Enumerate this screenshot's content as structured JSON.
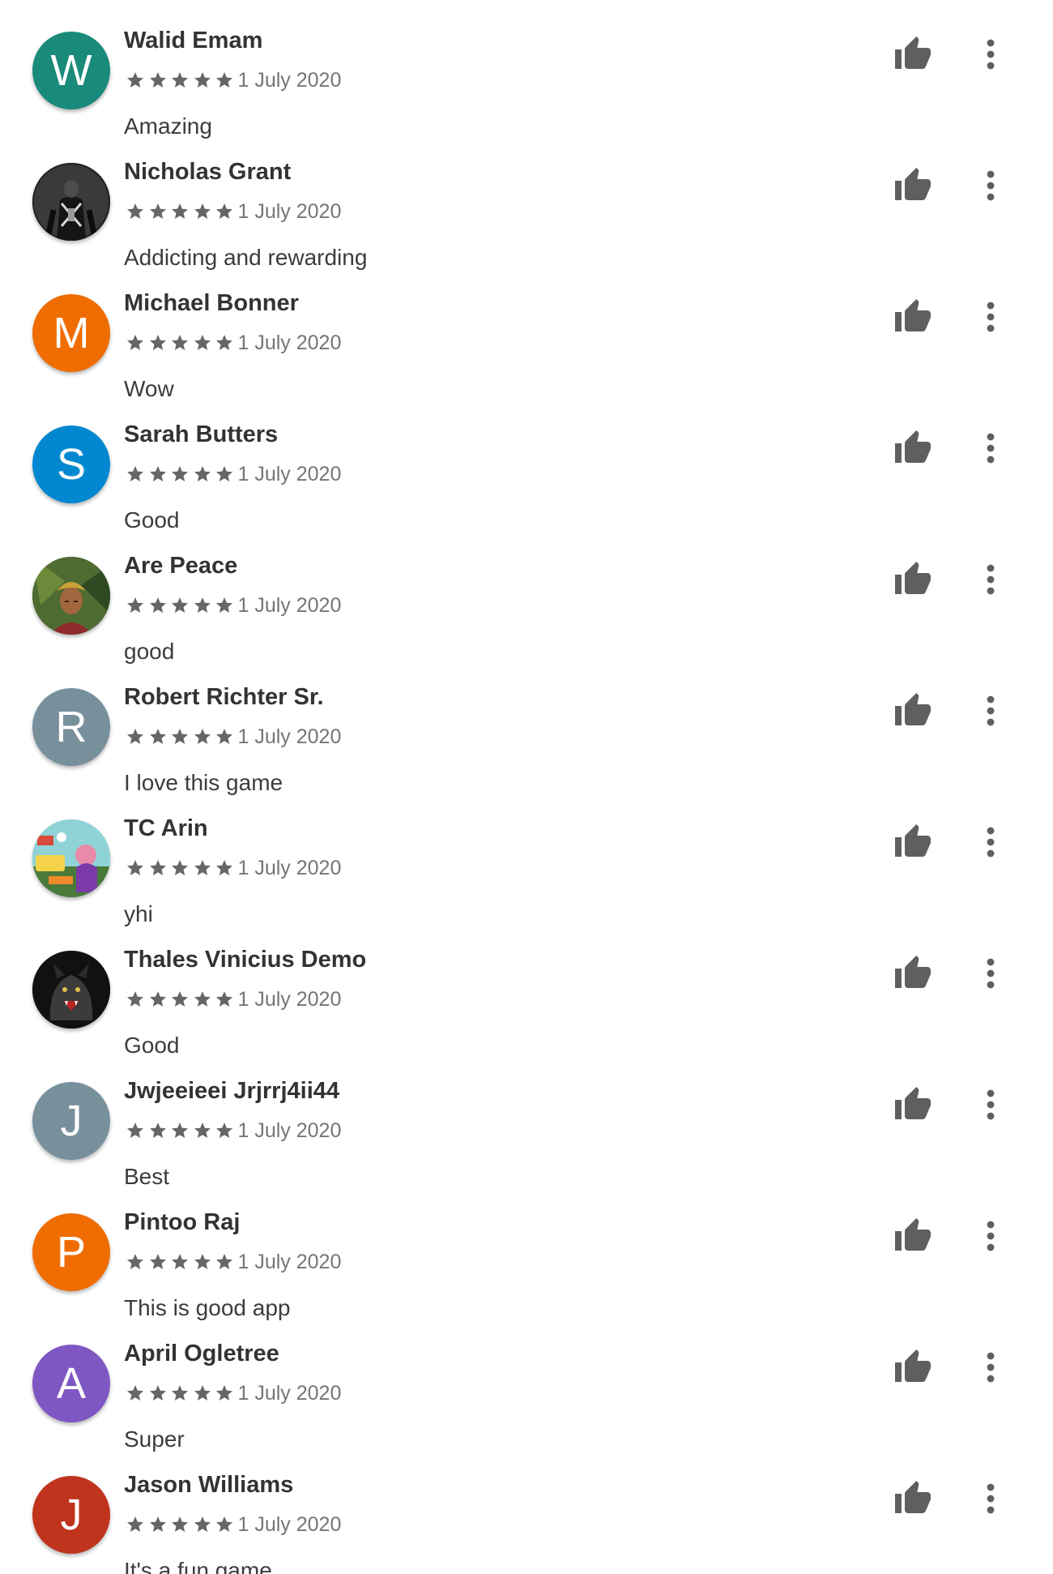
{
  "colors": {
    "star": "#666666",
    "icon": "#5f5f5f",
    "author": "#333333",
    "date": "#757575",
    "text": "#3c3c3c"
  },
  "icons": {
    "rating": "star-icon",
    "like": "thumb-up-icon",
    "more": "more-vert-icon"
  },
  "reviews": [
    {
      "author": "Walid Emam",
      "avatar": {
        "type": "letter",
        "letter": "W",
        "color": "#1a8a7a"
      },
      "rating": 5,
      "date": "1 July 2020",
      "text": "Amazing"
    },
    {
      "author": "Nicholas Grant",
      "avatar": {
        "type": "image",
        "subject": "armored-figure",
        "color": "#1e1e1e"
      },
      "rating": 5,
      "date": "1 July 2020",
      "text": "Addicting and rewarding"
    },
    {
      "author": "Michael Bonner",
      "avatar": {
        "type": "letter",
        "letter": "M",
        "color": "#ef6c00"
      },
      "rating": 5,
      "date": "1 July 2020",
      "text": "Wow"
    },
    {
      "author": "Sarah Butters",
      "avatar": {
        "type": "letter",
        "letter": "S",
        "color": "#0288d1"
      },
      "rating": 5,
      "date": "1 July 2020",
      "text": "Good"
    },
    {
      "author": "Are Peace",
      "avatar": {
        "type": "image",
        "subject": "person-portrait",
        "color": "#3e5a2a"
      },
      "rating": 5,
      "date": "1 July 2020",
      "text": "good"
    },
    {
      "author": "Robert Richter Sr.",
      "avatar": {
        "type": "letter",
        "letter": "R",
        "color": "#78909c"
      },
      "rating": 5,
      "date": "1 July 2020",
      "text": "I love this game"
    },
    {
      "author": "TC Arin",
      "avatar": {
        "type": "image",
        "subject": "cartoon-scene",
        "color": "#7ec8c8"
      },
      "rating": 5,
      "date": "1 July 2020",
      "text": "yhi"
    },
    {
      "author": "Thales Vinicius Demo",
      "avatar": {
        "type": "image",
        "subject": "werewolf",
        "color": "#1a1a1a"
      },
      "rating": 5,
      "date": "1 July 2020",
      "text": "Good"
    },
    {
      "author": "Jwjeeieei Jrjrrj4ii44",
      "avatar": {
        "type": "letter",
        "letter": "J",
        "color": "#78909c"
      },
      "rating": 5,
      "date": "1 July 2020",
      "text": "Best"
    },
    {
      "author": "Pintoo Raj",
      "avatar": {
        "type": "letter",
        "letter": "P",
        "color": "#ef6c00"
      },
      "rating": 5,
      "date": "1 July 2020",
      "text": "This is good app"
    },
    {
      "author": "April Ogletree",
      "avatar": {
        "type": "letter",
        "letter": "A",
        "color": "#7e57c2"
      },
      "rating": 5,
      "date": "1 July 2020",
      "text": "Super"
    },
    {
      "author": "Jason Williams",
      "avatar": {
        "type": "letter",
        "letter": "J",
        "color": "#c0341d"
      },
      "rating": 5,
      "date": "1 July 2020",
      "text": "It's a fun game"
    }
  ]
}
